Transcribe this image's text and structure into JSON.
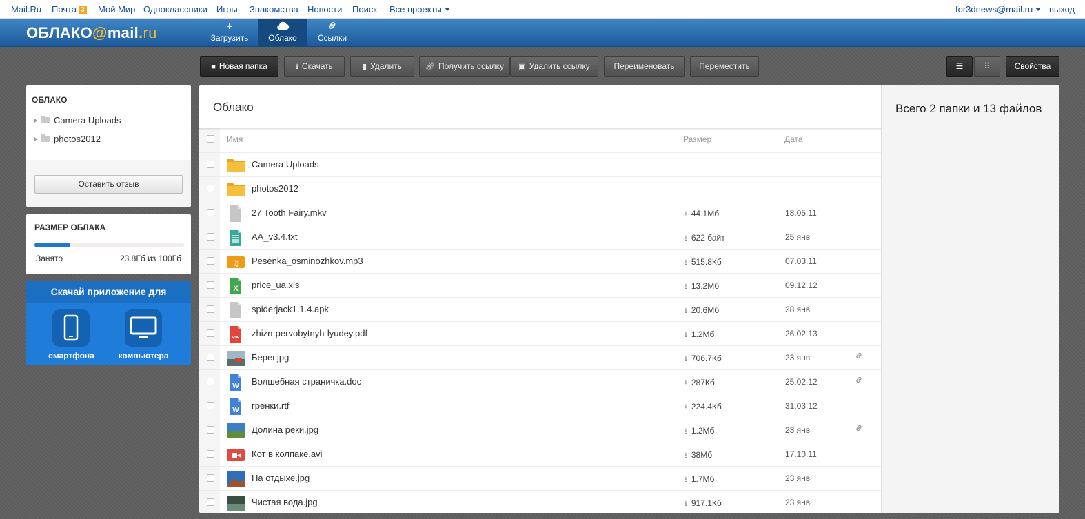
{
  "portal": {
    "links": [
      "Mail.Ru",
      "Почта",
      "Мой Мир",
      "Одноклассники",
      "Игры",
      "Знакомства",
      "Новости",
      "Поиск",
      "Все проекты"
    ],
    "mail_badge": "3",
    "user": "for3dnews@mail.ru",
    "logout": "выход"
  },
  "header": {
    "logo_main": "ОБЛАКО",
    "logo_at": "@",
    "logo_mail": "mail",
    "logo_dot": ".",
    "logo_ru": "ru",
    "nav": [
      {
        "label": "Загрузить",
        "icon": "plus-icon"
      },
      {
        "label": "Облако",
        "icon": "cloud-icon",
        "active": true
      },
      {
        "label": "Ссылки",
        "icon": "link-icon"
      }
    ]
  },
  "toolbar": {
    "new_folder": "Новая папка",
    "download": "Скачать",
    "delete": "Удалить",
    "get_link": "Получить ссылку",
    "delete_link": "Удалить ссылку",
    "rename": "Переименовать",
    "move": "Переместить",
    "properties": "Свойства"
  },
  "sidebar": {
    "tree_title": "ОБЛАКО",
    "tree_items": [
      "Camera Uploads",
      "photos2012"
    ],
    "feedback": "Оставить отзыв",
    "quota_title": "РАЗМЕР ОБЛАКА",
    "quota_label": "Занято",
    "quota_value": "23.8Гб из 100Гб",
    "quota_fraction": 0.238,
    "app_title": "Скачай приложение для",
    "app_phone": "смартфона",
    "app_pc": "компьютера"
  },
  "main": {
    "title": "Облако",
    "col_name": "Имя",
    "col_size": "Размер",
    "col_date": "Дата",
    "summary": "Всего 2 папки и 13 файлов",
    "files": [
      {
        "name": "Camera Uploads",
        "size": "",
        "date": "",
        "type": "folder",
        "link": false
      },
      {
        "name": "photos2012",
        "size": "",
        "date": "",
        "type": "folder",
        "link": false
      },
      {
        "name": "27 Tooth Fairy.mkv",
        "size": "44.1Мб",
        "date": "18.05.11",
        "type": "generic",
        "link": false
      },
      {
        "name": "AA_v3.4.txt",
        "size": "622 байт",
        "date": "25 янв",
        "type": "txt",
        "link": false
      },
      {
        "name": "Pesenka_osminozhkov.mp3",
        "size": "515.8Кб",
        "date": "07.03.11",
        "type": "audio",
        "link": false
      },
      {
        "name": "price_ua.xls",
        "size": "13.2Мб",
        "date": "09.12.12",
        "type": "xls",
        "link": false
      },
      {
        "name": "spiderjack1.1.4.apk",
        "size": "20.6Мб",
        "date": "28 янв",
        "type": "generic",
        "link": false
      },
      {
        "name": "zhizn-pervobytnyh-lyudey.pdf",
        "size": "1.2Мб",
        "date": "26.02.13",
        "type": "pdf",
        "link": false
      },
      {
        "name": "Берег.jpg",
        "size": "706.7Кб",
        "date": "23 янв",
        "type": "img1",
        "link": true
      },
      {
        "name": "Волшебная страничка.doc",
        "size": "287Кб",
        "date": "25.02.12",
        "type": "doc",
        "link": true
      },
      {
        "name": "гренки.rtf",
        "size": "224.4Кб",
        "date": "31.03.12",
        "type": "doc",
        "link": false
      },
      {
        "name": "Долина реки.jpg",
        "size": "1.2Мб",
        "date": "23 янв",
        "type": "img2",
        "link": true
      },
      {
        "name": "Кот в колпаке.avi",
        "size": "38Мб",
        "date": "17.10.11",
        "type": "video",
        "link": false
      },
      {
        "name": "На отдыхе.jpg",
        "size": "1.7Мб",
        "date": "23 янв",
        "type": "img3",
        "link": false
      },
      {
        "name": "Чистая вода.jpg",
        "size": "917.1Кб",
        "date": "23 янв",
        "type": "img4",
        "link": false
      }
    ]
  }
}
